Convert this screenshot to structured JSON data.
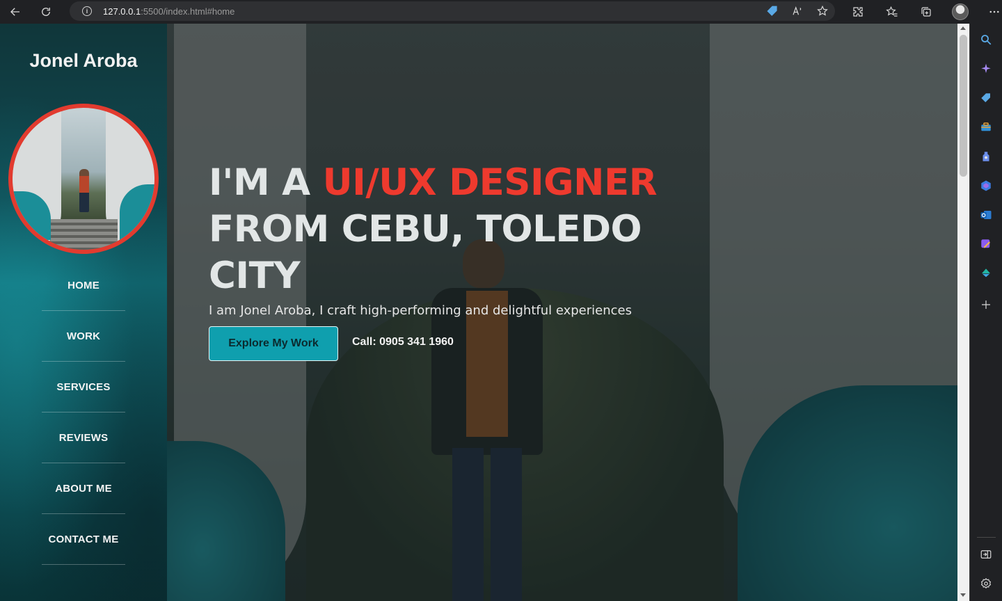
{
  "browser": {
    "url_host": "127.0.0.1",
    "url_path": ":5500/index.html#home"
  },
  "sidebar": {
    "brand": "Jonel Aroba",
    "nav": [
      {
        "label": "HOME"
      },
      {
        "label": "WORK"
      },
      {
        "label": "SERVICES"
      },
      {
        "label": "REVIEWS"
      },
      {
        "label": "ABOUT ME"
      },
      {
        "label": "CONTACT ME"
      }
    ]
  },
  "hero": {
    "headline_prefix": "I'M A ",
    "headline_accent": "UI/UX DESIGNER",
    "headline_suffix": " FROM CEBU, TOLEDO CITY",
    "subtitle": "I am Jonel Aroba, I craft high-performing and delightful experiences",
    "cta_label": "Explore My Work",
    "call_text": "Call: 0905 341 1960"
  },
  "colors": {
    "accent_red": "#ee3a2e",
    "accent_teal": "#0f9fae",
    "sidebar_teal": "#127680"
  },
  "edge_sidebar_icons": [
    "search-icon",
    "copilot-icon",
    "shopping-tag-icon",
    "tools-icon",
    "games-icon",
    "microsoft365-icon",
    "outlook-icon",
    "designer-icon",
    "drop-icon",
    "add-icon",
    "sidebar-toggle-icon",
    "settings-icon"
  ]
}
